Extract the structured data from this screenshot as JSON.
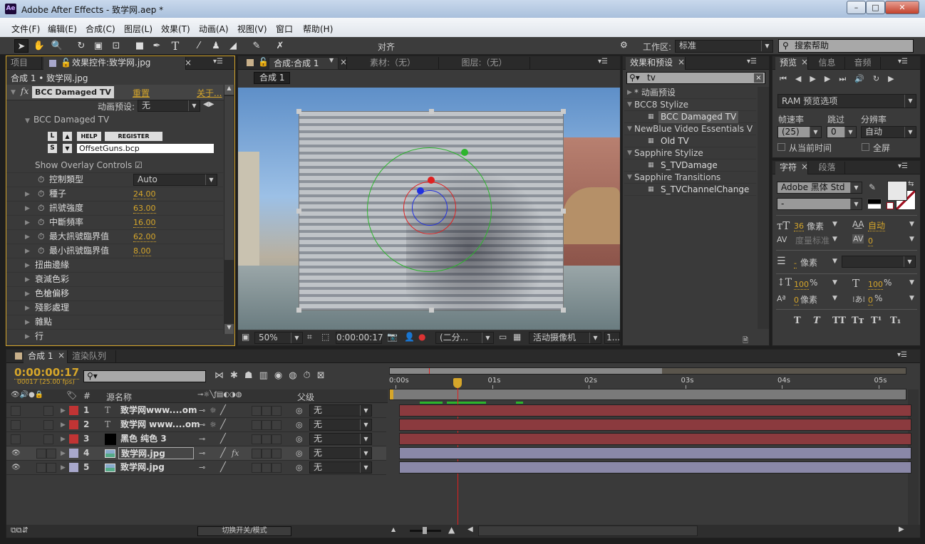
{
  "window": {
    "title": "Adobe After Effects - 致学网.aep *",
    "logo": "Ae",
    "min": "–",
    "max": "□",
    "close": "✕"
  },
  "menu": [
    "文件(F)",
    "编辑(E)",
    "合成(C)",
    "图层(L)",
    "效果(T)",
    "动画(A)",
    "视图(V)",
    "窗口",
    "帮助(H)"
  ],
  "toolbar": {
    "tools": [
      "selection-tool",
      "hand-tool",
      "zoom-tool",
      "rotate-tool",
      "camera-tool",
      "pan-behind-tool",
      "rectangle-tool",
      "pen-tool",
      "type-tool",
      "brush-tool",
      "clone-stamp-tool",
      "eraser-tool",
      "roto-brush-tool",
      "puppet-pin-tool"
    ],
    "snap_label": "对齐",
    "workspace_label": "工作区:",
    "workspace_value": "标准",
    "search_help": "搜索帮助"
  },
  "effect_controls": {
    "tab_project": "项目",
    "tab_label": "效果控件:致学网.jpg",
    "breadcrumb": "合成 1 • 致学网.jpg",
    "effect_name": "BCC Damaged TV",
    "reset": "重置",
    "about": "关于...",
    "preset_label": "动画预设:",
    "preset_value": "无",
    "group_name": "BCC Damaged TV",
    "btn_l": "L",
    "btn_s": "S",
    "btn_help": "HELP",
    "btn_register": "REGISTER",
    "preset_file": "OffsetGuns.bcp",
    "overlay_label": "Show Overlay Controls",
    "overlay_checked": true,
    "control_type_label": "控制類型",
    "control_type_value": "Auto",
    "params": [
      {
        "label": "種子",
        "value": "24.00"
      },
      {
        "label": "訊號強度",
        "value": "63.00"
      },
      {
        "label": "中斷頻率",
        "value": "16.00"
      },
      {
        "label": "最大訊號臨界值",
        "value": "62.00"
      },
      {
        "label": "最小訊號臨界值",
        "value": "8.00"
      }
    ],
    "groups": [
      "扭曲邊緣",
      "衰減色彩",
      "色槍偏移",
      "殘影處理",
      "雜點",
      "行"
    ]
  },
  "viewer": {
    "tab_label": "合成:合成 1",
    "footage_tab": "素材:（无）",
    "layer_tab": "图层:（无）",
    "comp_button": "合成 1",
    "zoom": "50%",
    "timecode": "0:00:00:17",
    "resolution": "(二分...",
    "camera": "活动摄像机",
    "views": "1..."
  },
  "effects_presets": {
    "tab_label": "效果和预设",
    "search_value": "tv",
    "items": [
      {
        "type": "category",
        "label": "* 动画预设",
        "open": false
      },
      {
        "type": "category",
        "label": "BCC8 Stylize",
        "open": true
      },
      {
        "type": "effect",
        "label": "BCC Damaged TV",
        "selected": true
      },
      {
        "type": "category",
        "label": "NewBlue Video Essentials V",
        "open": true
      },
      {
        "type": "effect",
        "label": "Old TV"
      },
      {
        "type": "category",
        "label": "Sapphire Stylize",
        "open": true
      },
      {
        "type": "effect",
        "label": "S_TVDamage"
      },
      {
        "type": "category",
        "label": "Sapphire Transitions",
        "open": true
      },
      {
        "type": "effect",
        "label": "S_TVChannelChange"
      }
    ]
  },
  "preview": {
    "tabs": [
      "预览",
      "信息",
      "音频"
    ],
    "ram_options": "RAM 预览选项",
    "frame_rate_label": "帧速率",
    "skip_label": "跳过",
    "resolution_label": "分辨率",
    "frame_rate": "(25)",
    "skip": "0",
    "resolution": "自动",
    "from_current": "从当前时间",
    "fullscreen": "全屏"
  },
  "character": {
    "tabs": [
      "字符",
      "段落"
    ],
    "font": "Adobe 黑体 Std",
    "style": "-",
    "size": "36",
    "size_unit": "像素",
    "leading": "自动",
    "kerning": "度量标准",
    "tracking": "0",
    "stroke": "-",
    "stroke_unit": "像素",
    "vscale": "100",
    "hscale": "100",
    "pct": "%",
    "baseline": "0",
    "baseline_unit": "像素",
    "tsume": "0",
    "styles": [
      "T",
      "T",
      "TT",
      "Tт",
      "T¹",
      "T₁"
    ],
    "fill_color": "#e8e8e8",
    "stroke_color": "#ffffff"
  },
  "timeline": {
    "tab_label": "合成 1",
    "render_tab": "渲染队列",
    "timecode": "0:00:00:17",
    "frame_info": "00017 (25.00 fps)",
    "col_hash": "#",
    "col_source": "源名称",
    "col_parent": "父级",
    "ruler": [
      "0:00s",
      "01s",
      "02s",
      "03s",
      "04s",
      "05s"
    ],
    "switch_label": "切换开关/模式",
    "layers": [
      {
        "num": "1",
        "name": "致学网www....om",
        "type": "text",
        "label_color": "#c03434",
        "visible": false,
        "parent": "无"
      },
      {
        "num": "2",
        "name": "致学网 www....om",
        "type": "text",
        "label_color": "#c03434",
        "visible": false,
        "parent": "无"
      },
      {
        "num": "3",
        "name": "黑色 纯色 3",
        "type": "solid",
        "label_color": "#c03434",
        "visible": false,
        "parent": "无"
      },
      {
        "num": "4",
        "name": "致学网.jpg",
        "type": "image",
        "label_color": "#a8a8cc",
        "visible": true,
        "parent": "无",
        "fx": "fx",
        "selected": true
      },
      {
        "num": "5",
        "name": "致学网.jpg",
        "type": "image",
        "label_color": "#a8a8cc",
        "visible": true,
        "parent": "无"
      }
    ]
  },
  "colors": {
    "accent": "#d6a62a",
    "panel": "#3a3a3a",
    "red_track": "#8b3a3e",
    "purple_track": "#8a88a8",
    "cti": "#e02020"
  }
}
